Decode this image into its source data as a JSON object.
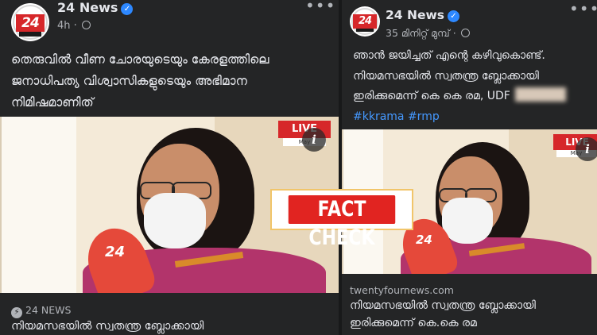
{
  "left_post": {
    "page_name": "24 News",
    "time": "4h",
    "text_lines": [
      "തെരുവിൽ വീണ ചോരയുടെയും കേരളത്തിലെ",
      "ജനാധിപത്യ വിശ്വാസികളുടെയും അഭിമാന",
      "നിമിഷമാണിത്"
    ],
    "avatar_logo": "24",
    "live_badge": "LIVE",
    "live_sub": "May",
    "mic_label": "24",
    "link_site": "24 NEWS",
    "link_title": "നിയമസഭയിൽ സ്വതന്ത്ര ബ്ലോക്കായി"
  },
  "right_post": {
    "page_name": "24 News",
    "time": "35 മിനിറ്റ് മുമ്പ്",
    "text_lines": [
      "ഞാൻ ജയിച്ചത് എന്റെ കഴിവുകൊണ്ട്.",
      "നിയമസഭയിൽ സ്വതന്ത്ര ബ്ലോക്കായി",
      "ഇരിക്കുമെന്ന് കെ കെ രമ, UDF"
    ],
    "hashtags": "#kkrama #rmp",
    "avatar_logo": "24",
    "live_badge": "LIVE",
    "live_sub": "May",
    "mic_label": "24",
    "link_site": "twentyfournews.com",
    "link_title_lines": [
      "നിയമസഭയിൽ സ്വതന്ത്ര ബ്ലോക്കായി",
      "ഇരിക്കുമെന്ന് കെ.കെ രമ"
    ]
  },
  "stamp": {
    "label": "FACT CHECK"
  },
  "colors": {
    "panel": "#242526",
    "link": "#4599ff",
    "verified": "#2d88ff",
    "stamp_red": "#e12421",
    "brand_red": "#d6272a"
  },
  "icons": [
    "verified-icon",
    "globe-icon",
    "more-icon",
    "info-icon",
    "bolt-icon"
  ]
}
